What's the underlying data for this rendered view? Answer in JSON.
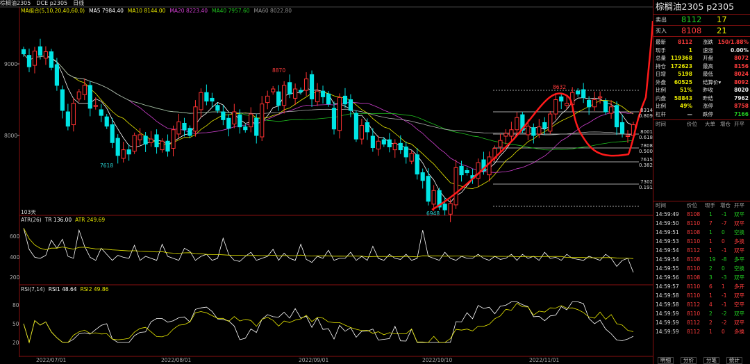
{
  "colors": {
    "up": "#ff3232",
    "down": "#00e5e5",
    "ma5": "#ffffff",
    "ma10": "#e8e800",
    "ma20": "#d040d0",
    "ma40": "#20c020",
    "ma60": "#b0b0b0",
    "atr": "#ffffff",
    "atr_ma": "#e8e800",
    "rsi1": "#ffffff",
    "rsi2": "#e8e800",
    "border": "#8a1010"
  },
  "header": {
    "title": "棕榈油2305",
    "code": "DCE p2305",
    "period": "日线"
  },
  "legend": {
    "ma_label": "MA组合(5,10,20,40,60,0)",
    "ma5": "MA5 7984.40",
    "ma10": "MA10 8144.00",
    "ma20": "MA20 8223.40",
    "ma40": "MA40 7957.60",
    "ma60": "MA60 8022.80",
    "days": "103天"
  },
  "price_axis": [
    "9000",
    "8000"
  ],
  "marks": {
    "high1": "8870",
    "low1": "7618",
    "high2": "8632",
    "low2": "6948"
  },
  "fib": [
    {
      "price": "8314",
      "ratio": "0.809"
    },
    {
      "price": "8001",
      "ratio": "0.618"
    },
    {
      "price": "7808",
      "ratio": "0.500"
    },
    {
      "price": "7615",
      "ratio": "0.382"
    },
    {
      "price": "7302",
      "ratio": "0.191"
    }
  ],
  "atr": {
    "label": "ATR(26)",
    "tr": "TR 136.00",
    "atr": "ATR 249.69",
    "axis": [
      "600",
      "400",
      "200"
    ]
  },
  "rsi": {
    "label": "RSI(7,14)",
    "rsi1": "RSI1 48.64",
    "rsi2": "RSI2 49.86",
    "axis": [
      "80",
      "50",
      "20"
    ]
  },
  "dates": [
    "2022/07/01",
    "2022/08/01",
    "2022/09/01",
    "2022/10/10",
    "2022/11/01"
  ],
  "panel": {
    "title": "棕榈油2305 p2305",
    "sell": {
      "label": "卖出",
      "price": "8112",
      "vol": "17"
    },
    "buy": {
      "label": "买入",
      "price": "8108",
      "vol": "21"
    },
    "quotes": [
      {
        "l1": "最新",
        "v1": "8112",
        "c1": "red",
        "l2": "涨跌",
        "v2": "150/1.88%",
        "c2": "red"
      },
      {
        "l1": "现手",
        "v1": "1",
        "c1": "yellow",
        "l2": "速涨",
        "v2": "0.00%",
        "c2": "white"
      },
      {
        "l1": "总量",
        "v1": "119368",
        "c1": "yellow",
        "l2": "开盘",
        "v2": "8072",
        "c2": "red"
      },
      {
        "l1": "持仓",
        "v1": "172623",
        "c1": "yellow",
        "l2": "最高",
        "v2": "8156",
        "c2": "red"
      },
      {
        "l1": "日增",
        "v1": "5198",
        "c1": "yellow",
        "l2": "最低",
        "v2": "8024",
        "c2": "red"
      },
      {
        "l1": "外盘",
        "v1": "60525",
        "c1": "yellow",
        "l2": "结算价▾",
        "v2": "8092",
        "c2": "red"
      },
      {
        "l1": "比例",
        "v1": "51%",
        "c1": "yellow",
        "l2": "昨收",
        "v2": "8020",
        "c2": "white"
      },
      {
        "l1": "内盘",
        "v1": "58843",
        "c1": "yellow",
        "l2": "昨结",
        "v2": "7962",
        "c2": "white"
      },
      {
        "l1": "比例",
        "v1": "49%",
        "c1": "yellow",
        "l2": "涨停",
        "v2": "8758",
        "c2": "red"
      },
      {
        "l1": "杠杆",
        "v1": "—",
        "c1": "white",
        "l2": "跌停",
        "v2": "7166",
        "c2": "green"
      }
    ],
    "tick_headers": [
      "时间",
      "价位",
      "大单",
      "增仓",
      "开平"
    ],
    "trade_headers": [
      "时间",
      "价位",
      "现手",
      "增仓",
      "开平"
    ],
    "trades": [
      {
        "t": "14:59:49",
        "p": "8108",
        "pc": "red",
        "q": "1",
        "qc": "green",
        "d": "-1",
        "dc": "green",
        "k": "双平",
        "kc": "green"
      },
      {
        "t": "14:59:50",
        "p": "8110",
        "pc": "red",
        "q": "7",
        "qc": "red",
        "d": "-7",
        "dc": "red",
        "k": "双平",
        "kc": "red"
      },
      {
        "t": "14:59:51",
        "p": "8108",
        "pc": "red",
        "q": "1",
        "qc": "green",
        "d": "0",
        "dc": "green",
        "k": "空换",
        "kc": "green"
      },
      {
        "t": "14:59:53",
        "p": "8110",
        "pc": "red",
        "q": "1",
        "qc": "red",
        "d": "0",
        "dc": "red",
        "k": "多换",
        "kc": "red"
      },
      {
        "t": "14:59:54",
        "p": "8112",
        "pc": "red",
        "q": "1",
        "qc": "red",
        "d": "-1",
        "dc": "red",
        "k": "双平",
        "kc": "red"
      },
      {
        "t": "14:59:54",
        "p": "8108",
        "pc": "red",
        "q": "19",
        "qc": "green",
        "d": "-8",
        "dc": "green",
        "k": "多平",
        "kc": "green"
      },
      {
        "t": "14:59:55",
        "p": "8110",
        "pc": "red",
        "q": "2",
        "qc": "green",
        "d": "0",
        "dc": "green",
        "k": "空换",
        "kc": "green"
      },
      {
        "t": "14:59:56",
        "p": "8108",
        "pc": "red",
        "q": "3",
        "qc": "green",
        "d": "-3",
        "dc": "green",
        "k": "双平",
        "kc": "green"
      },
      {
        "t": "14:59:57",
        "p": "8110",
        "pc": "red",
        "q": "6",
        "qc": "red",
        "d": "1",
        "dc": "red",
        "k": "多开",
        "kc": "red"
      },
      {
        "t": "14:59:58",
        "p": "8110",
        "pc": "red",
        "q": "1",
        "qc": "red",
        "d": "-1",
        "dc": "red",
        "k": "双平",
        "kc": "red"
      },
      {
        "t": "14:59:58",
        "p": "8112",
        "pc": "red",
        "q": "4",
        "qc": "red",
        "d": "-1",
        "dc": "red",
        "k": "空平",
        "kc": "red"
      },
      {
        "t": "14:59:59",
        "p": "8110",
        "pc": "red",
        "q": "2",
        "qc": "green",
        "d": "-2",
        "dc": "green",
        "k": "双平",
        "kc": "green"
      },
      {
        "t": "14:59:59",
        "p": "8112",
        "pc": "red",
        "q": "2",
        "qc": "red",
        "d": "-2",
        "dc": "red",
        "k": "双平",
        "kc": "red"
      },
      {
        "t": "14:59:59",
        "p": "8112",
        "pc": "red",
        "q": "1",
        "qc": "red",
        "d": "0",
        "dc": "red",
        "k": "多换",
        "kc": "red"
      }
    ],
    "tabs": [
      "明细",
      "分价",
      "分笔",
      "统计"
    ]
  }
}
